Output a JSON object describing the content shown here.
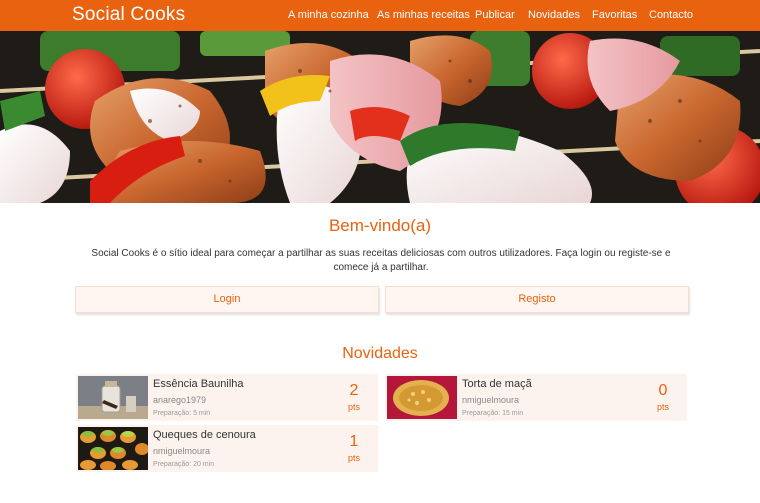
{
  "brand": "Social Cooks",
  "nav": [
    "A minha cozinha",
    "As minhas receitas",
    "Publicar",
    "Novidades",
    "Favoritas",
    "Contacto"
  ],
  "colors": {
    "accent": "#e8620f",
    "card_bg": "#fdf3ee"
  },
  "welcome": {
    "title": "Bem-vindo(a)",
    "text": "Social Cooks é o sítio ideal para começar a partilhar as suas receitas deliciosas com outros utilizadores. Faça login ou registe-se e comece já a partilhar.",
    "login": "Login",
    "register": "Registo"
  },
  "news": {
    "title": "Novidades",
    "pts_label": "pts",
    "recipes": [
      {
        "title": "Essência Baunilha",
        "author": "anarego1979",
        "prep": "Preparação: 5 min",
        "points": "2"
      },
      {
        "title": "Torta de maçã",
        "author": "nmiguelmoura",
        "prep": "Preparação: 15 min",
        "points": "0"
      },
      {
        "title": "Queques de cenoura",
        "author": "nmiguelmoura",
        "prep": "Preparação: 20 min",
        "points": "1"
      }
    ]
  }
}
